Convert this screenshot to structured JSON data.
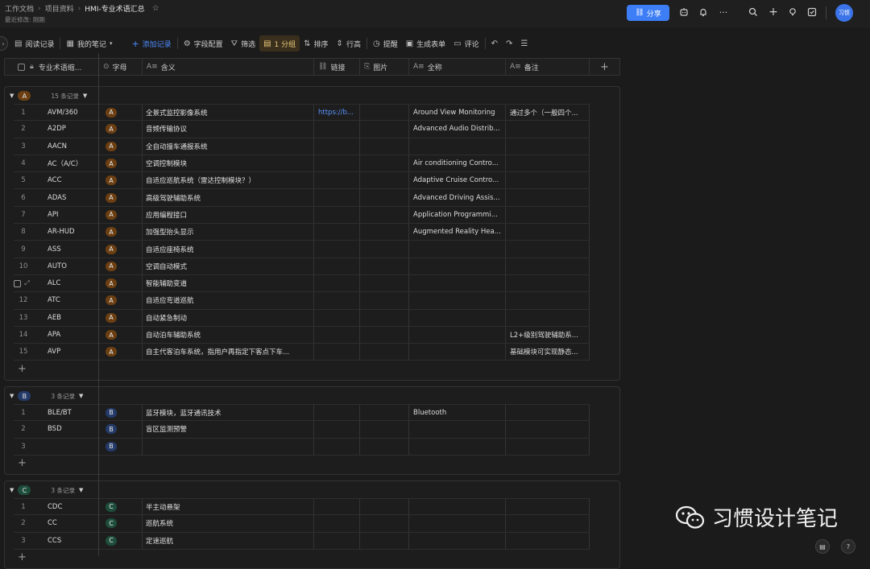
{
  "breadcrumb": [
    "工作文档",
    "项目资料",
    "HMI-专业术语汇总"
  ],
  "subtitle": "最近修改: 刚刚",
  "share_label": "分享",
  "avatar_text": "习惯",
  "toolbar": {
    "read_log": "阅读记录",
    "my_notes": "我的笔记",
    "add_record": "添加记录",
    "field_config": "字段配置",
    "filter": "筛选",
    "group": "1 分组",
    "sort": "排序",
    "row_height": "行高",
    "remind": "提醒",
    "generate_form": "生成表单",
    "comment": "评论"
  },
  "columns": {
    "abbr": "专业术语缩...",
    "letter": "字母",
    "meaning": "含义",
    "link": "链接",
    "image": "图片",
    "fullname": "全称",
    "note": "备注"
  },
  "groups": [
    {
      "letter": "A",
      "count": "15 条记录",
      "color": "#6b3f12",
      "rows": [
        {
          "n": "1",
          "abbr": "AVM/360",
          "meaning": "全景式监控影像系统",
          "link": "https://b...",
          "full": "Around View Monitoring",
          "note": "通过多个（一般四个..."
        },
        {
          "n": "2",
          "abbr": "A2DP",
          "meaning": "音频传输协议",
          "link": "",
          "full": "Advanced Audio Distrib...",
          "note": ""
        },
        {
          "n": "3",
          "abbr": "AACN",
          "meaning": "全自动撞车通报系统",
          "link": "",
          "full": "",
          "note": ""
        },
        {
          "n": "4",
          "abbr": "AC（A/C）",
          "meaning": "空调控制模块",
          "link": "",
          "full": "Air conditioning Contro...",
          "note": ""
        },
        {
          "n": "5",
          "abbr": "ACC",
          "meaning": "自适应巡航系统（雷达控制模块？）",
          "link": "",
          "full": "Adaptive Cruise Contro...",
          "note": ""
        },
        {
          "n": "6",
          "abbr": "ADAS",
          "meaning": "高级驾驶辅助系统",
          "link": "",
          "full": "Advanced Driving Assis...",
          "note": ""
        },
        {
          "n": "7",
          "abbr": "API",
          "meaning": "应用编程接口",
          "link": "",
          "full": "Application Programmi...",
          "note": ""
        },
        {
          "n": "8",
          "abbr": "AR-HUD",
          "meaning": "加强型抬头显示",
          "link": "",
          "full": "Augmented Reality Hea...",
          "note": ""
        },
        {
          "n": "9",
          "abbr": "ASS",
          "meaning": "自适应座椅系统",
          "link": "",
          "full": "",
          "note": ""
        },
        {
          "n": "10",
          "abbr": "AUTO",
          "meaning": "空调自动模式",
          "link": "",
          "full": "",
          "note": ""
        },
        {
          "n": "",
          "abbr": "ALC",
          "meaning": "智能辅助变道",
          "link": "",
          "full": "",
          "note": "",
          "hover": true
        },
        {
          "n": "12",
          "abbr": "ATC",
          "meaning": "自适应弯道巡航",
          "link": "",
          "full": "",
          "note": ""
        },
        {
          "n": "13",
          "abbr": "AEB",
          "meaning": "自动紧急制动",
          "link": "",
          "full": "",
          "note": ""
        },
        {
          "n": "14",
          "abbr": "APA",
          "meaning": "自动泊车辅助系统",
          "link": "",
          "full": "",
          "note": "L2+级别驾驶辅助系..."
        },
        {
          "n": "15",
          "abbr": "AVP",
          "meaning": "自主代客泊车系统，指用户再指定下客点下车...",
          "link": "",
          "full": "",
          "note": "基础模块可实现静态..."
        }
      ]
    },
    {
      "letter": "B",
      "count": "3 条记录",
      "color": "#243a68",
      "rows": [
        {
          "n": "1",
          "abbr": "BLE/BT",
          "meaning": "蓝牙模块，蓝牙通讯技术",
          "link": "",
          "full": "Bluetooth",
          "note": ""
        },
        {
          "n": "2",
          "abbr": "BSD",
          "meaning": "盲区监测预警",
          "link": "",
          "full": "",
          "note": ""
        },
        {
          "n": "3",
          "abbr": "",
          "meaning": "",
          "link": "",
          "full": "",
          "note": ""
        }
      ]
    },
    {
      "letter": "C",
      "count": "3 条记录",
      "color": "#1e4d3c",
      "rows": [
        {
          "n": "1",
          "abbr": "CDC",
          "meaning": "半主动悬架",
          "link": "",
          "full": "",
          "note": ""
        },
        {
          "n": "2",
          "abbr": "CC",
          "meaning": "巡航系统",
          "link": "",
          "full": "",
          "note": ""
        },
        {
          "n": "3",
          "abbr": "CCS",
          "meaning": "定速巡航",
          "link": "",
          "full": "",
          "note": ""
        }
      ]
    }
  ],
  "watermark": "习惯设计笔记"
}
